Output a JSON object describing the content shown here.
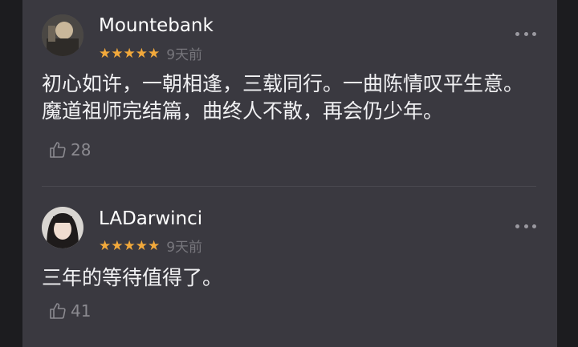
{
  "comments": [
    {
      "username": "Mountebank",
      "stars": "★★★★★",
      "time": "9天前",
      "text": "初心如许，一朝相逢，三载同行。一曲陈情叹平生意。魔道祖师完结篇，曲终人不散，再会仍少年。",
      "likes": "28",
      "avatar_icon": "user-avatar"
    },
    {
      "username": "LADarwinci",
      "stars": "★★★★★",
      "time": "9天前",
      "text": "三年的等待值得了。",
      "likes": "41",
      "avatar_icon": "user-avatar"
    }
  ],
  "colors": {
    "background": "#3a3940",
    "star": "#f2a93b",
    "meta_text": "#77767c"
  },
  "icons": {
    "more": "more-dots-icon",
    "like": "thumbs-up-icon"
  }
}
